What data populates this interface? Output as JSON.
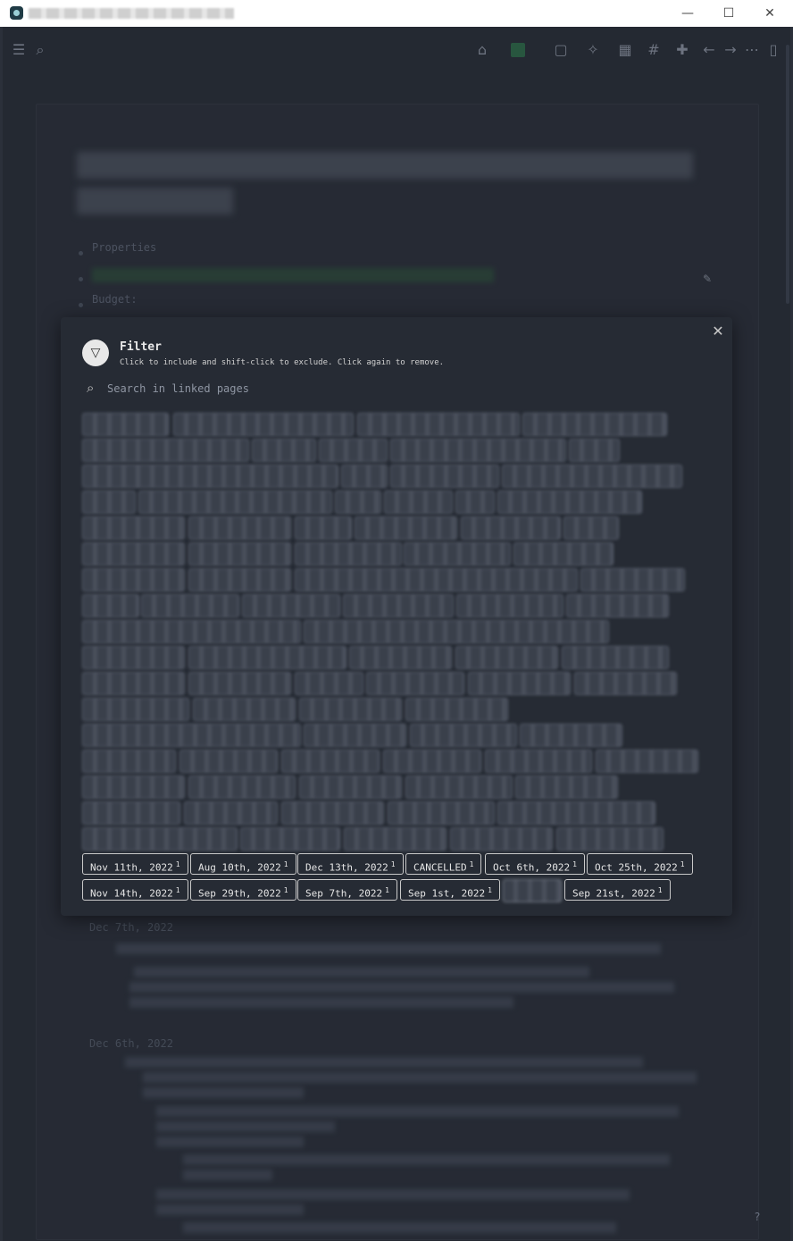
{
  "window": {
    "minimize": "—",
    "maximize": "☐",
    "close": "✕"
  },
  "toolbar": {
    "icons": [
      "menu-icon",
      "search-icon",
      "home-icon",
      "graph-icon",
      "page-icon",
      "sparkle-icon",
      "calendar-icon",
      "hash-icon",
      "puzzle-icon",
      "back-icon",
      "forward-icon",
      "more-icon",
      "sidebar-icon"
    ]
  },
  "page": {
    "properties_label": "Properties",
    "budget_label": "Budget:",
    "sections": [
      {
        "date": "Dec 7th, 2022"
      },
      {
        "date": "Dec 6th, 2022"
      }
    ]
  },
  "filter": {
    "title": "Filter",
    "subtitle": "Click to include and shift-click to exclude. Click again to remove.",
    "search_placeholder": "Search in linked pages",
    "close_label": "✕",
    "visible_chips": [
      {
        "label": "Nov 11th, 2022",
        "count": "1"
      },
      {
        "label": "Aug 10th, 2022",
        "count": "1"
      },
      {
        "label": "Dec 13th, 2022",
        "count": "1"
      },
      {
        "label": "CANCELLED",
        "count": "1"
      },
      {
        "label": "Oct 6th, 2022",
        "count": "1"
      },
      {
        "label": "Oct 25th, 2022",
        "count": "1"
      },
      {
        "label": "Nov 14th, 2022",
        "count": "1"
      },
      {
        "label": "Sep 29th, 2022",
        "count": "1"
      },
      {
        "label": "Sep 7th, 2022",
        "count": "1"
      },
      {
        "label": "Sep 1st, 2022",
        "count": "1"
      },
      {
        "label": "Sep 21st, 2022",
        "count": "1"
      }
    ]
  },
  "help": "?"
}
